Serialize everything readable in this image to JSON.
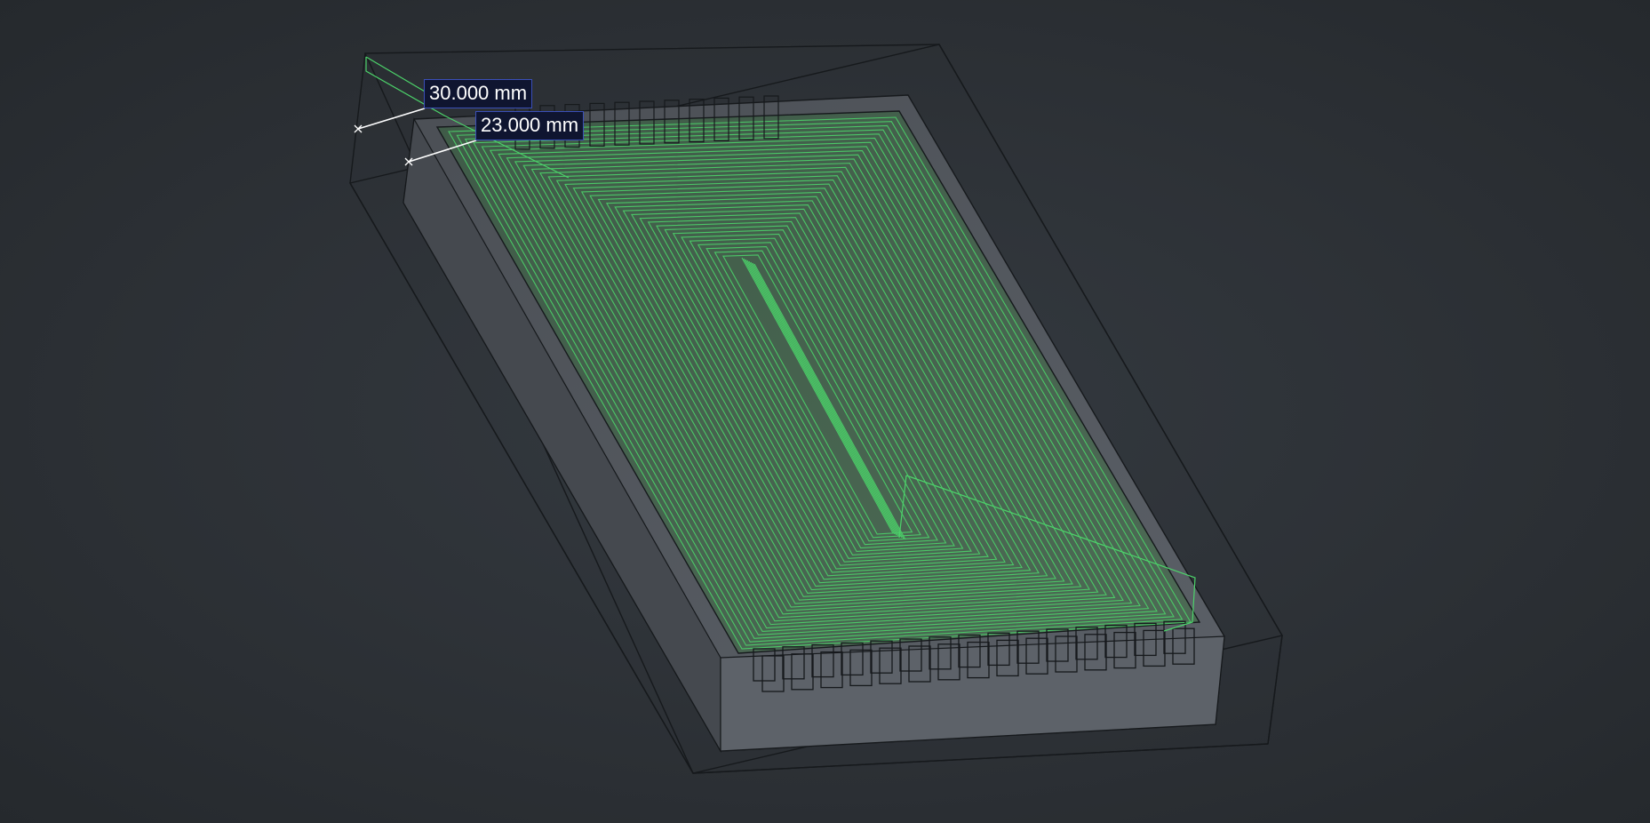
{
  "dimensions": {
    "outer_label": "30.000 mm",
    "inner_label": "23.000 mm"
  },
  "colors": {
    "background": "#2d3136",
    "toolpath": "#4cd36a",
    "wireframe": "#15181b",
    "stock_face": "#555a61",
    "label_bg": "#0f1530",
    "label_border": "#3a4fb8"
  }
}
